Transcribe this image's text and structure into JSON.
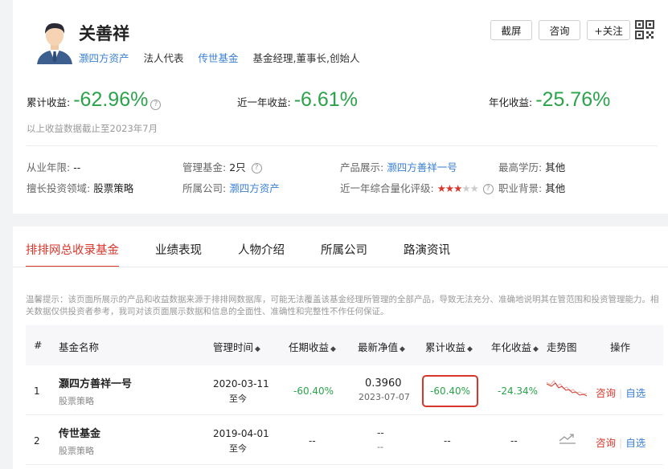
{
  "manager": {
    "name": "关善祥",
    "company_link": "灏四方资产",
    "role1": "法人代表",
    "fund_link": "传世基金",
    "role2": "基金经理,董事长,创始人"
  },
  "actions": {
    "screenshot": "截屏",
    "consult": "咨询",
    "follow": "+关注"
  },
  "returns": {
    "cumulative_label": "累计收益:",
    "cumulative_value": "-62.96%",
    "year_label": "近一年收益:",
    "year_value": "-6.61%",
    "annual_label": "年化收益:",
    "annual_value": "-25.76%",
    "note": "以上收益数据截止至2023年7月"
  },
  "info": {
    "years_label": "从业年限:",
    "years_value": "--",
    "managed_label": "管理基金:",
    "managed_value": "2只",
    "product_label": "产品展示:",
    "product_value": "灏四方善祥一号",
    "edu_label": "最高学历:",
    "edu_value": "其他",
    "field_label": "擅长投资领域:",
    "field_value": "股票策略",
    "company_label": "所属公司:",
    "company_value": "灏四方资产",
    "rating_label": "近一年综合量化评级:",
    "rating_stars": 3,
    "career_label": "职业背景:",
    "career_value": "其他"
  },
  "tabs": [
    "排排网总收录基金",
    "业绩表现",
    "人物介绍",
    "所属公司",
    "路演资讯"
  ],
  "tip": "温馨提示：该页面所展示的产品和收益数据来源于排排网数据库，可能无法覆盖该基金经理所管理的全部产品，导致无法充分、准确地说明其在管范围和投资管理能力。相关数据仅供投资者参考，我司对该页面展示数据和信息的全面性、准确性和完整性不作任何保证。",
  "table": {
    "headers": {
      "idx": "#",
      "name": "基金名称",
      "period": "管理时间",
      "tenure": "任期收益",
      "nav": "最新净值",
      "cum": "累计收益",
      "annual": "年化收益",
      "trend": "走势图",
      "ops": "操作"
    },
    "rows": [
      {
        "idx": "1",
        "name": "灏四方善祥一号",
        "strategy": "股票策略",
        "start": "2020-03-11",
        "end": "至今",
        "tenure": "-60.40%",
        "nav": "0.3960",
        "nav_date": "2023-07-07",
        "cum": "-60.40%",
        "annual": "-24.34%",
        "op1": "咨询",
        "op2": "自选"
      },
      {
        "idx": "2",
        "name": "传世基金",
        "strategy": "股票策略",
        "start": "2019-04-01",
        "end": "至今",
        "tenure": "--",
        "nav": "--",
        "nav_date": "--",
        "cum": "--",
        "annual": "--",
        "op1": "咨询",
        "op2": "自选"
      }
    ]
  }
}
